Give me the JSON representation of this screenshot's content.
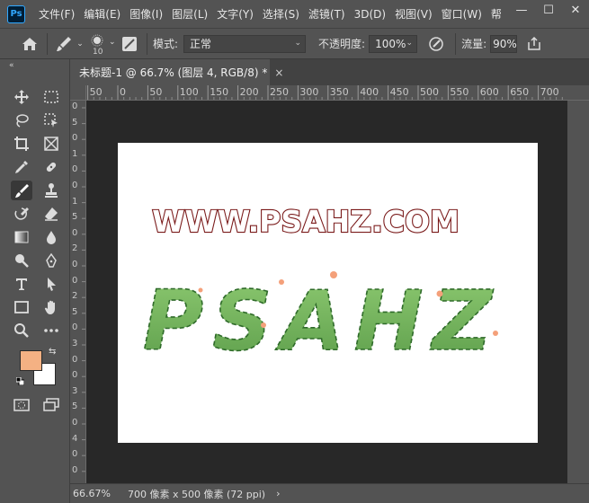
{
  "app": {
    "logo_text": "Ps"
  },
  "menu": [
    "文件(F)",
    "编辑(E)",
    "图像(I)",
    "图层(L)",
    "文字(Y)",
    "选择(S)",
    "滤镜(T)",
    "3D(D)",
    "视图(V)",
    "窗口(W)",
    "帮"
  ],
  "window_controls": {
    "minimize": "—",
    "maximize": "☐",
    "close": "✕"
  },
  "options": {
    "brush_size": "10",
    "mode_label": "模式:",
    "mode_value": "正常",
    "opacity_label": "不透明度:",
    "opacity_value": "100%",
    "flow_label": "流量:",
    "flow_value": "90%"
  },
  "document": {
    "tab_title": "未标题-1 @ 66.7% (图层 4, RGB/8) *",
    "close": "×"
  },
  "ruler": {
    "top_labels": [
      "50",
      "0",
      "50",
      "100",
      "150",
      "200",
      "250",
      "300",
      "350",
      "400",
      "450",
      "500",
      "550",
      "600",
      "650",
      "700"
    ],
    "left_labels": [
      "0",
      "5",
      "0",
      "1",
      "0",
      "0",
      "1",
      "5",
      "0",
      "2",
      "0",
      "0",
      "2",
      "5",
      "0",
      "3",
      "0",
      "0",
      "3",
      "5",
      "0",
      "4",
      "0",
      "0"
    ]
  },
  "artwork": {
    "title_text": "WWW.PSAHZ.COM",
    "cactus_text": "PSAHZ"
  },
  "colors": {
    "foreground": "#f4b183",
    "background": "#ffffff",
    "title_fill": "#ffffff",
    "title_stroke": "#7a1a1a",
    "cactus_green": "#6db35a",
    "cactus_dark": "#2f6b2a",
    "flower": "#f4a07a"
  },
  "status": {
    "zoom": "66.67%",
    "doc_info": "700 像素 x 500 像素 (72 ppi)",
    "arrow": "›"
  }
}
